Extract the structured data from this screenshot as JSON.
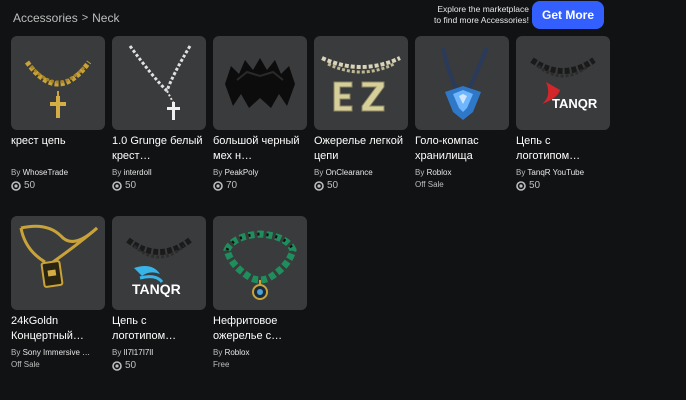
{
  "breadcrumb": {
    "root": "Accessories",
    "separator": ">",
    "current": "Neck"
  },
  "promo": {
    "line1": "Explore the marketplace",
    "line2": "to find more Accessories!"
  },
  "get_more_label": "Get More",
  "items": [
    {
      "name": "крест цепь",
      "by": "By",
      "creator": "WhoseTrade",
      "price": "50",
      "thumb_icon": "gold-cross-chain-icon"
    },
    {
      "name": "1.0 Grunge белый крест…",
      "by": "By",
      "creator": "interdoll",
      "price": "50",
      "thumb_icon": "silver-cross-chain-icon"
    },
    {
      "name": "большой черный мех н…",
      "by": "By",
      "creator": "PeakPoly",
      "price": "70",
      "thumb_icon": "black-fur-collar-icon"
    },
    {
      "name": "Ожерелье легкой цепи",
      "by": "By",
      "creator": "OnClearance",
      "price": "50",
      "thumb_icon": "ez-chain-icon"
    },
    {
      "name": "Голо-компас хранилища",
      "by": "By",
      "creator": "Roblox",
      "status": "Off Sale",
      "thumb_icon": "holo-compass-icon"
    },
    {
      "name": "Цепь с логотипом…",
      "by": "By",
      "creator": "TanqR YouTube",
      "price": "50",
      "thumb_icon": "tanqr-red-chain-icon"
    },
    {
      "name": "24kGoldn Концертный…",
      "by": "By",
      "creator": "Sony Immersive …",
      "status": "Off Sale",
      "thumb_icon": "gold-pendant-chain-icon"
    },
    {
      "name": "Цепь с логотипом…",
      "by": "By",
      "creator": "lI7l17I7lI",
      "price": "50",
      "thumb_icon": "tanqr-blue-chain-icon"
    },
    {
      "name": "Нефритовое ожерелье с…",
      "by": "By",
      "creator": "Roblox",
      "status": "Free",
      "thumb_icon": "jade-necklace-icon"
    }
  ]
}
